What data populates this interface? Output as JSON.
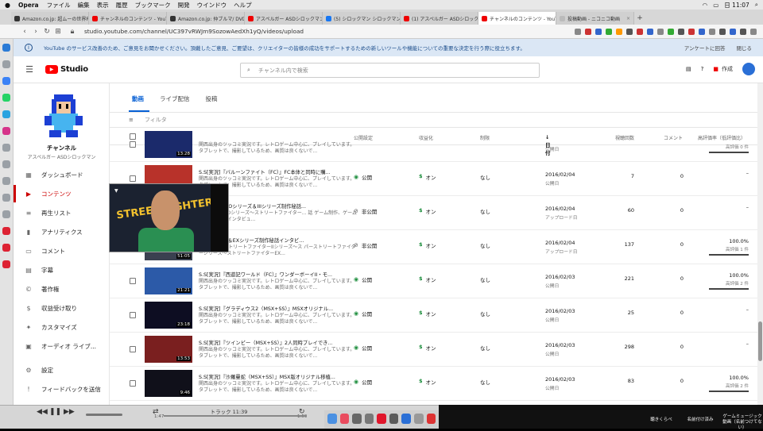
{
  "menubar": {
    "app": "Opera",
    "items": [
      "ファイル",
      "編集",
      "表示",
      "履歴",
      "ブックマーク",
      "開発",
      "ウインドウ",
      "ヘルプ"
    ],
    "clock": "日 11:07"
  },
  "tabs": [
    {
      "label": "Amazon.co.jp: 超ムーの世界R",
      "color": "#333"
    },
    {
      "label": "チャンネルのコンテンツ - YouT",
      "color": "#e00"
    },
    {
      "label": "Amazon.co.jp: 仲ブルマ/ DVD",
      "color": "#333"
    },
    {
      "label": "アスペルガー ASDシロックマン",
      "color": "#e00"
    },
    {
      "label": "(5) シロックマン シロックマン",
      "color": "#1877f2"
    },
    {
      "label": "(1) アスペルガー ASDシロックマ",
      "color": "#e00"
    },
    {
      "label": "チャンネルのコンテンツ - YouTu",
      "color": "#e00"
    },
    {
      "label": "投稿動画 - ニコニコ動画",
      "color": "#bbb"
    }
  ],
  "address": {
    "url": "studio.youtube.com/channel/UC397vRWJm9SozowAedXh1yQ/videos/upload"
  },
  "notice": {
    "text": "YouTube のサービス改善のため、ご意見をお聞かせください。頂戴したご意見、ご要望は、クリエイターの皆様の成功をサポートするための新しいツールや機能についての重要な決定を行う際に役立ちます。",
    "survey": "アンケートに回答",
    "close": "閉じる"
  },
  "header": {
    "logo": "Studio",
    "search_placeholder": "チャンネル内で検索",
    "create": "作成"
  },
  "channel": {
    "name": "チャンネル",
    "sub": "アスペルガー ASDシロックマン"
  },
  "nav": [
    "ダッシュボード",
    "コンテンツ",
    "再生リスト",
    "アナリティクス",
    "コメント",
    "字幕",
    "著作権",
    "収益受け取り",
    "カスタマイズ",
    "オーディオ ライブ...",
    "設定",
    "フィードバックを送信"
  ],
  "content_tabs": [
    "動画",
    "ライブ配信",
    "投稿"
  ],
  "filter": "フィルタ",
  "columns": {
    "video": "動画",
    "visibility": "公開設定",
    "monetization": "収益化",
    "restrictions": "制限",
    "date": "日付",
    "views": "視聴回数",
    "comments": "コメント",
    "rating": "高評価率（低評価比）"
  },
  "rows": [
    {
      "title": "",
      "desc": "関西出身のツッコミ実況です。レトロゲーム中心に、プレイしています。タブレットで、撮影しているため、画質は良くないで...",
      "dur": "13:28",
      "vis": "",
      "mon": "",
      "rest": "",
      "date": "",
      "dsub": "公開日",
      "views": "",
      "cmts": "",
      "rate": "",
      "rsub": "高評価 0 件",
      "bar": true,
      "bg": "#1b2a6b"
    },
    {
      "title": "S.S[実況]『バルーンファイト（FC）』FC本体と同時に購...",
      "desc": "関西出身のツッコミ実況です。レトロゲーム中心に、プレイしています。タブレットで、撮影しているため、画質は良くないで...",
      "dur": "",
      "vis": "公開",
      "mon": "オン",
      "rest": "なし",
      "date": "2016/02/04",
      "dsub": "公開日",
      "views": "7",
      "cmts": "0",
      "rate": "–",
      "rsub": "",
      "bar": false,
      "bg": "#b8322a"
    },
    {
      "title": "アイターZEROシリーズ＆IIIシリーズ制作秘話...",
      "desc": "アイターZEROシリーズ～ストリートファイター...\n話 ゲーム制作、ゲームクリエイターインタビュ...",
      "dur": "",
      "vis": "非公開",
      "mon": "オン",
      "rest": "なし",
      "date": "2016/02/04",
      "dsub": "アップロード日",
      "views": "60",
      "cmts": "0",
      "rate": "–",
      "rsub": "",
      "bar": false,
      "bg": "#3a4050",
      "off": true
    },
    {
      "title": "アイターI・II＆EXシリーズ制作秘話インタビ...",
      "desc": "アイターI～ストリートファイターIIシリーズ～ス\nパーストリートファイターシリーズ～ストリートファイターEX...",
      "dur": "51:05",
      "vis": "非公開",
      "mon": "オン",
      "rest": "なし",
      "date": "2016/02/04",
      "dsub": "アップロード日",
      "views": "137",
      "cmts": "0",
      "rate": "100.0%",
      "rsub": "高評価 1 件",
      "bar": true,
      "bg": "#3a4050",
      "off": true
    },
    {
      "title": "S.S[実況]『西遊記ワールド（FC）』ワンダーボーイII・モ...",
      "desc": "関西出身のツッコミ実況です。レトロゲーム中心に、プレイしています。タブレットで、撮影しているため、画質は良くないで...",
      "dur": "21:21",
      "vis": "公開",
      "mon": "オン",
      "rest": "なし",
      "date": "2016/02/03",
      "dsub": "公開日",
      "views": "221",
      "cmts": "0",
      "rate": "100.0%",
      "rsub": "高評価 2 件",
      "bar": true,
      "bg": "#2c5aa8"
    },
    {
      "title": "S.S[実況]『グラディウス2（MSX+SS）』MSXオリジナル...",
      "desc": "関西出身のツッコミ実況です。レトロゲーム中心に、プレイしています。タブレットで、撮影しているため、画質は良くないで...",
      "dur": "23:18",
      "vis": "公開",
      "mon": "オン",
      "rest": "なし",
      "date": "2016/02/03",
      "dsub": "公開日",
      "views": "25",
      "cmts": "0",
      "rate": "–",
      "rsub": "",
      "bar": false,
      "bg": "#0d0d22"
    },
    {
      "title": "S.S[実況]『ツインビー（MSX+SS）』2人同時プレイでき...",
      "desc": "関西出身のツッコミ実況です。レトロゲーム中心に、プレイしています。タブレットで、撮影しているため、画質は良くないで...",
      "dur": "13:53",
      "vis": "公開",
      "mon": "オン",
      "rest": "なし",
      "date": "2016/02/03",
      "dsub": "公開日",
      "views": "298",
      "cmts": "0",
      "rate": "–",
      "rsub": "",
      "bar": false,
      "bg": "#7a1f1f"
    },
    {
      "title": "S.S[実況]『沙羅曼蛇（MSX+SS）』MSX版オリジナル移植...",
      "desc": "関西出身のツッコミ実況です。レトロゲーム中心に、プレイしています。タブレットで、撮影しているため、画質は良くないで...",
      "dur": "9:46",
      "vis": "公開",
      "mon": "オン",
      "rest": "なし",
      "date": "2016/02/03",
      "dsub": "公開日",
      "views": "83",
      "cmts": "0",
      "rate": "100.0%",
      "rsub": "高評価 2 件",
      "bar": true,
      "bg": "#10101a"
    }
  ],
  "player": {
    "track": "トラック 11:39",
    "elapsed": "1:47",
    "remaining": "1:59"
  },
  "desktop": {
    "label1": "聴きくらべ",
    "label2": "名前付け済み",
    "label3": "ゲームミュージック動画（名前つけてない）"
  }
}
